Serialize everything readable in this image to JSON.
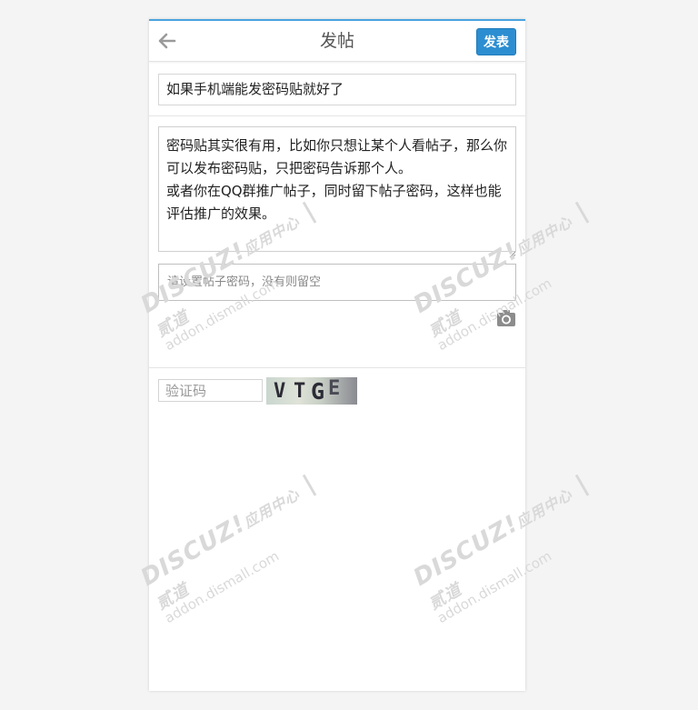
{
  "header": {
    "title": "发帖",
    "post_label": "发表"
  },
  "form": {
    "subject_value": "如果手机端能发密码贴就好了",
    "message_value": "密码贴其实很有用，比如你只想让某个人看帖子，那么你可以发布密码贴，只把密码告诉那个人。\n或者你在QQ群推广帖子，同时留下帖子密码，这样也能评估推广的效果。",
    "password_placeholder": "请设置帖子密码，没有则留空",
    "captcha_placeholder": "验证码",
    "captcha_chars": [
      "V",
      "T",
      "G",
      "E"
    ]
  },
  "watermark": {
    "brand": "DISCUZ!",
    "center": "应用中心",
    "partner": "贰道",
    "domain": "addon.dismall.com"
  },
  "icons": {
    "back": "arrow-left-icon",
    "camera": "camera-icon"
  },
  "colors": {
    "accent": "#2c8ed1",
    "top_border": "#4aa3df"
  }
}
